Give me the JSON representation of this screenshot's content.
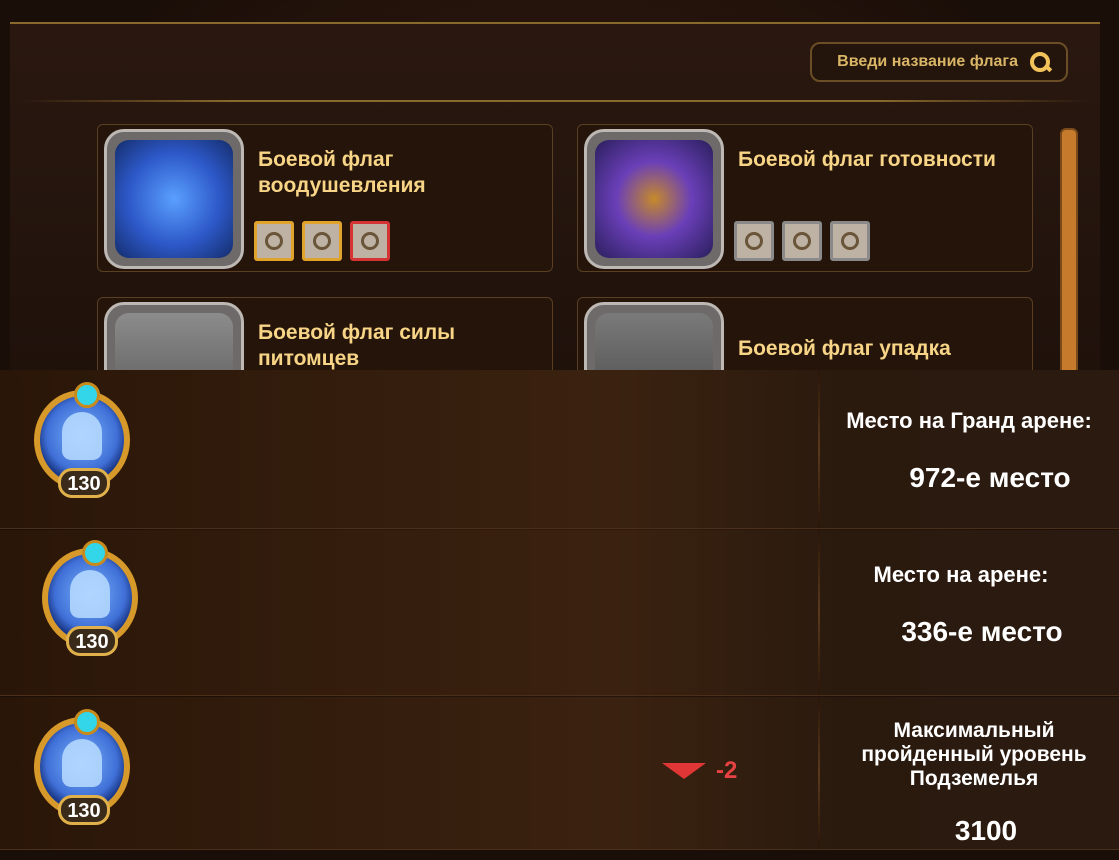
{
  "search": {
    "placeholder": "Введи название флага"
  },
  "flags": [
    {
      "name": "Боевой флаг воодушевления"
    },
    {
      "name": "Боевой флаг готовности"
    },
    {
      "name": "Боевой флаг силы питомцев"
    },
    {
      "name": "Боевой флаг упадка"
    }
  ],
  "rankings": [
    {
      "level": "130",
      "label": "Место на Гранд арене:",
      "value": "972-е место"
    },
    {
      "level": "130",
      "label": "Место на арене:",
      "value": "336-е место"
    },
    {
      "level": "130",
      "label": "Максимальный пройденный уровень Подземелья",
      "value": "3100",
      "change": "-2"
    }
  ],
  "colors": {
    "accent": "#f5d58a",
    "panel": "#241409",
    "down": "#e03636"
  }
}
